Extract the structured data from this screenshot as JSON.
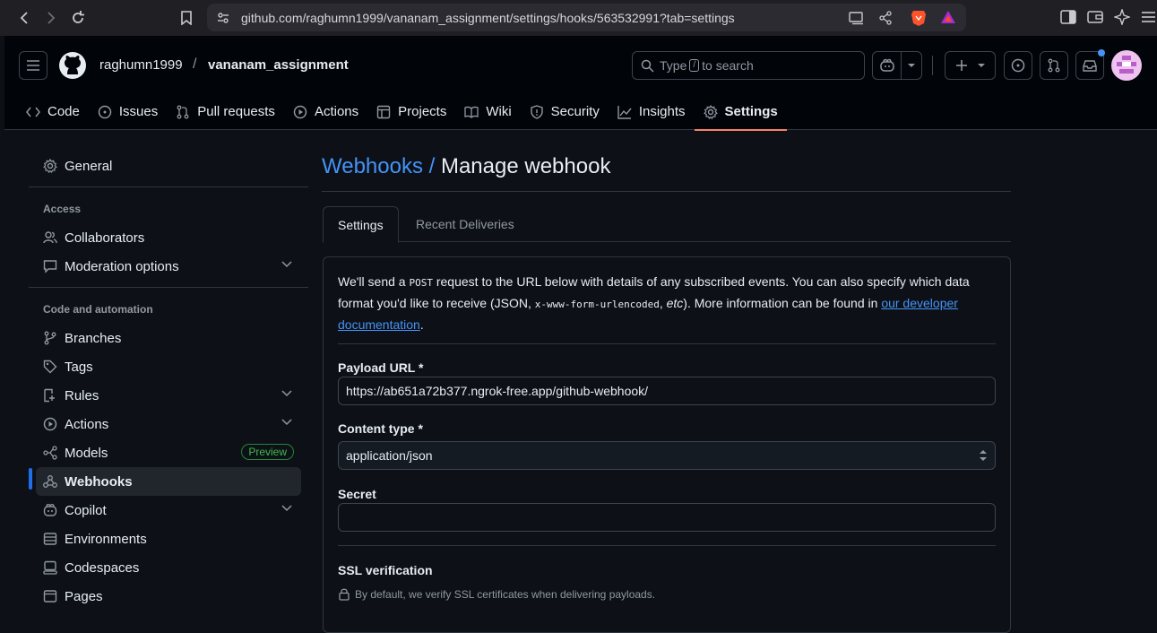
{
  "browser": {
    "url": "github.com/raghumn1999/vananam_assignment/settings/hooks/563532991?tab=settings"
  },
  "header": {
    "owner": "raghumn1999",
    "separator": "/",
    "repo": "vananam_assignment",
    "search_prefix": "Type",
    "search_key": "/",
    "search_suffix": "to search"
  },
  "repo_tabs": [
    {
      "label": "Code",
      "icon": "code-icon"
    },
    {
      "label": "Issues",
      "icon": "issue-icon"
    },
    {
      "label": "Pull requests",
      "icon": "pull-request-icon"
    },
    {
      "label": "Actions",
      "icon": "play-icon"
    },
    {
      "label": "Projects",
      "icon": "table-icon"
    },
    {
      "label": "Wiki",
      "icon": "book-icon"
    },
    {
      "label": "Security",
      "icon": "shield-icon"
    },
    {
      "label": "Insights",
      "icon": "graph-icon"
    },
    {
      "label": "Settings",
      "icon": "gear-icon",
      "active": true
    }
  ],
  "sidebar": {
    "general": "General",
    "access_heading": "Access",
    "collaborators": "Collaborators",
    "moderation": "Moderation options",
    "code_heading": "Code and automation",
    "branches": "Branches",
    "tags": "Tags",
    "rules": "Rules",
    "actions": "Actions",
    "models": "Models",
    "models_badge": "Preview",
    "webhooks": "Webhooks",
    "copilot": "Copilot",
    "environments": "Environments",
    "codespaces": "Codespaces",
    "pages": "Pages"
  },
  "main": {
    "breadcrumb": "Webhooks /",
    "title": "Manage webhook",
    "tab_settings": "Settings",
    "tab_deliveries": "Recent Deliveries",
    "intro_1": "We'll send a ",
    "intro_post": "POST",
    "intro_2": " request to the URL below with details of any subscribed events. You can also specify which data format you'd like to receive (JSON, ",
    "intro_code": "x-www-form-urlencoded",
    "intro_3": ", ",
    "intro_etc": "etc",
    "intro_4": "). More information can be found in ",
    "intro_link": "our developer documentation",
    "intro_5": ".",
    "payload_label": "Payload URL *",
    "payload_value": "https://ab651a72b377.ngrok-free.app/github-webhook/",
    "content_type_label": "Content type *",
    "content_type_value": "application/json",
    "secret_label": "Secret",
    "secret_value": "",
    "ssl_label": "SSL verification",
    "ssl_note": "By default, we verify SSL certificates when delivering payloads."
  },
  "colors": {
    "accent": "#4493f8",
    "tab_underline": "#f78166",
    "active_indicator": "#1f6feb",
    "preview_badge": "#3fb950"
  }
}
